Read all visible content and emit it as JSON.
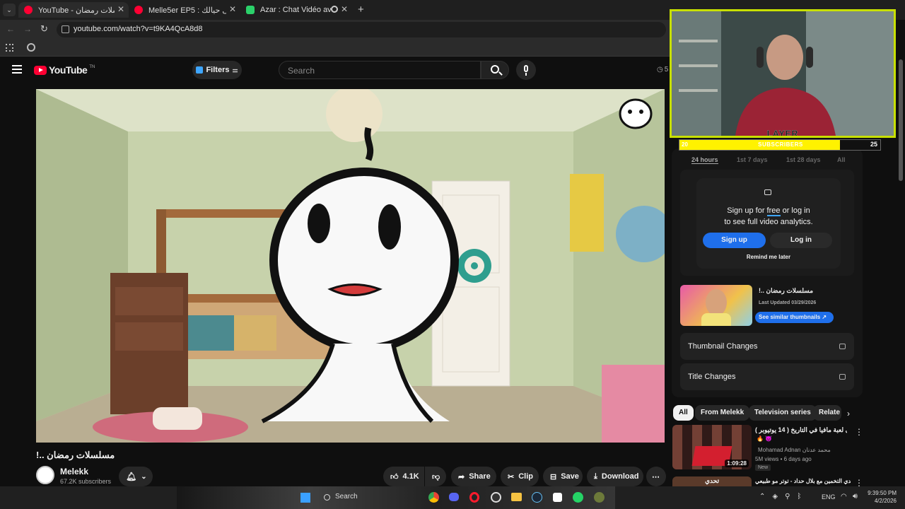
{
  "browser": {
    "tabs": [
      {
        "label": "YouTube - مسلسلات رمضان !..",
        "color": "#ff0033"
      },
      {
        "label": "Melle5er EP5 : لطيف على حيالك",
        "color": "#ff0033"
      },
      {
        "label": "Azar : Chat Vidéo avec de r",
        "color": "#2bd16a"
      }
    ],
    "new_tab": "+",
    "url": "youtube.com/watch?v=t9KA4QcA8d8"
  },
  "youtube": {
    "logo": "YouTube",
    "logo_super": "TN",
    "filters_label": "Filters",
    "search_placeholder": "Search",
    "header_right_count": "5"
  },
  "video": {
    "title": "!.. مسلسلات رمضان",
    "channel": "Melekk",
    "subscribers": "67.2K subscribers",
    "actions": {
      "likes": "4.1K",
      "share": "Share",
      "clip": "Clip",
      "save": "Save",
      "download": "Download"
    }
  },
  "overlay": {
    "name": "LAYER",
    "subs_label": "SUBSCRIBERS",
    "subs_current": "20",
    "subs_goal": "25",
    "subs_progress": 0.8
  },
  "analytics": {
    "tabs": [
      "24 hours",
      "1st 7 days",
      "1st 28 days",
      "All"
    ],
    "signup_text_1": "Sign up for",
    "signup_free": "free",
    "signup_text_2": "or log in",
    "signup_text_3": "to see full video analytics.",
    "signup_btn": "Sign up",
    "login_btn": "Log in",
    "remind": "Remind me later",
    "thumb_title": "!.. مسلسلات رمضان",
    "last_updated": "Last Updated 03/29/2026",
    "similar_btn": "See similar thumbnails",
    "thumbnail_changes": "Thumbnail Changes",
    "title_changes": "Title Changes"
  },
  "related": {
    "chips": [
      "All",
      "From Melekk",
      "Television series",
      "Relate"
    ],
    "items": [
      {
        "title": "أقوى لعبة مافيا في التاريخ ( 14 يوتيوبر )",
        "emoji": "🔥 😈",
        "channel": "Mohamad Adnan محمد عدنان",
        "meta": "5M views • 6 days ago",
        "badge": "New",
        "duration": "1:09:28"
      },
      {
        "title": "تحدي التخمين مع بلال حداد - توتر مو طبيعي",
        "thumb_text": "تحدي"
      }
    ]
  },
  "taskbar": {
    "search": "Search",
    "lang": "ENG",
    "time": "9:39:50 PM",
    "date": "4/2/2026"
  }
}
